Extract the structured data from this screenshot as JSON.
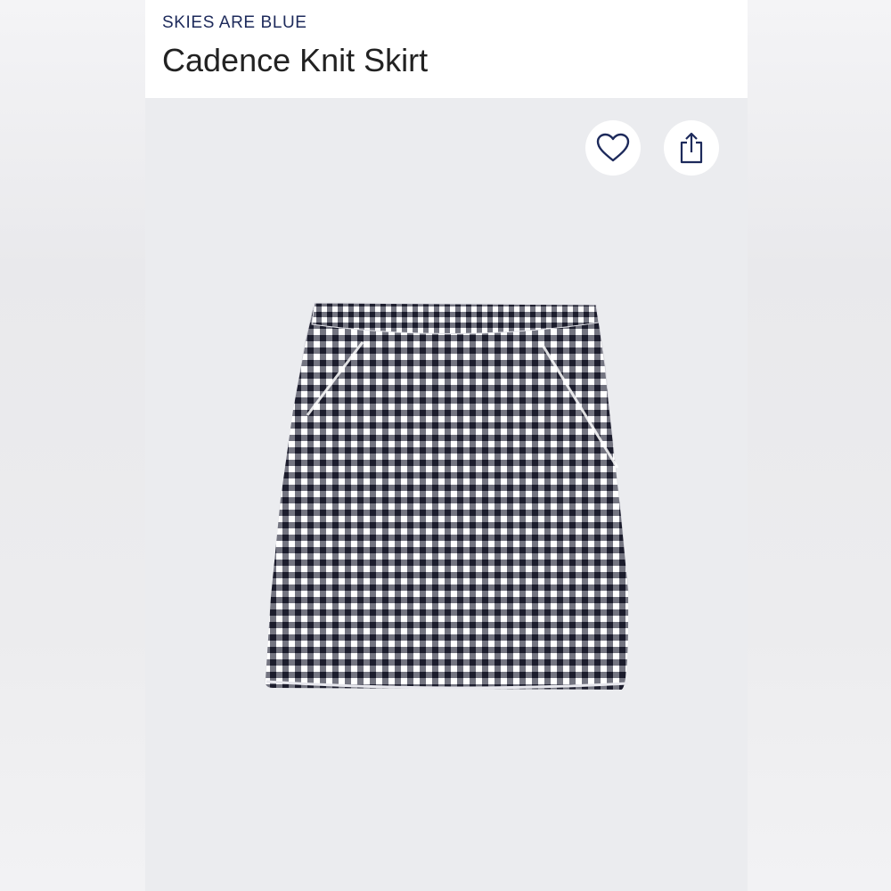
{
  "product": {
    "brand": "SKIES ARE BLUE",
    "title": "Cadence Knit Skirt"
  },
  "actions": {
    "favorite_icon": "heart-icon",
    "share_icon": "share-icon"
  },
  "colors": {
    "brand_text": "#1d2a5b",
    "title_text": "#222222",
    "image_background": "#ebecef",
    "gingham_dark": "#1f2033",
    "gingham_light": "#ffffff"
  }
}
